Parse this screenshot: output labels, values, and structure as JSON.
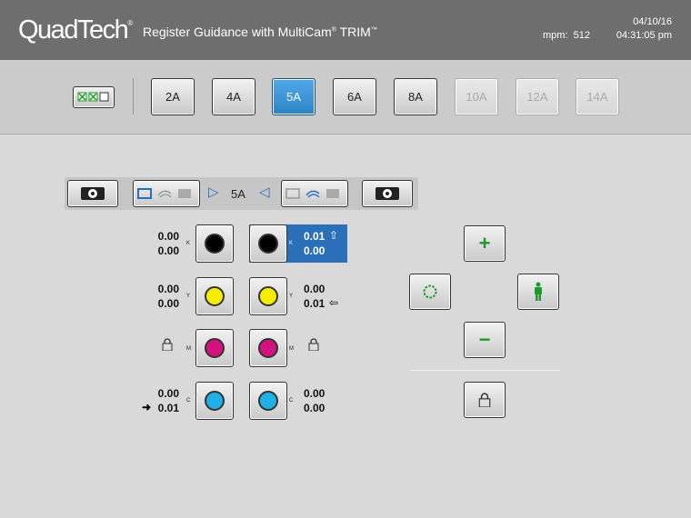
{
  "header": {
    "logo": "QuadTech",
    "logo_mark": "®",
    "title": "Register Guidance with MultiCam",
    "title_reg": "®",
    "title_product": "TRIM",
    "title_tm": "™",
    "mpm_label": "mpm:",
    "mpm_value": "512",
    "date": "04/10/16",
    "time": "04:31:05 pm"
  },
  "tabs": [
    {
      "label": "2A",
      "state": "normal"
    },
    {
      "label": "4A",
      "state": "normal"
    },
    {
      "label": "5A",
      "state": "selected"
    },
    {
      "label": "6A",
      "state": "normal"
    },
    {
      "label": "8A",
      "state": "normal"
    },
    {
      "label": "10A",
      "state": "disabled"
    },
    {
      "label": "12A",
      "state": "disabled"
    },
    {
      "label": "14A",
      "state": "disabled"
    }
  ],
  "camera_strip": {
    "unit_label": "5A"
  },
  "colors": [
    {
      "name": "K",
      "hex": "#000000",
      "left_top": "0.00",
      "left_bottom": "0.00",
      "right_top": "0.01",
      "right_bottom": "0.00"
    },
    {
      "name": "Y",
      "hex": "#f5ec00",
      "left_top": "0.00",
      "left_bottom": "0.00",
      "right_top": "0.00",
      "right_bottom": "0.01"
    },
    {
      "name": "M",
      "hex": "#d4127e",
      "left_locked": true,
      "right_locked": true
    },
    {
      "name": "C",
      "hex": "#1fb0e6",
      "left_top": "0.00",
      "left_bottom": "0.01",
      "right_top": "0.00",
      "right_bottom": "0.00"
    }
  ],
  "controls": {
    "plus": "+",
    "minus": "−"
  },
  "accent": "#2a6fb8",
  "green": "#1f9a2a"
}
